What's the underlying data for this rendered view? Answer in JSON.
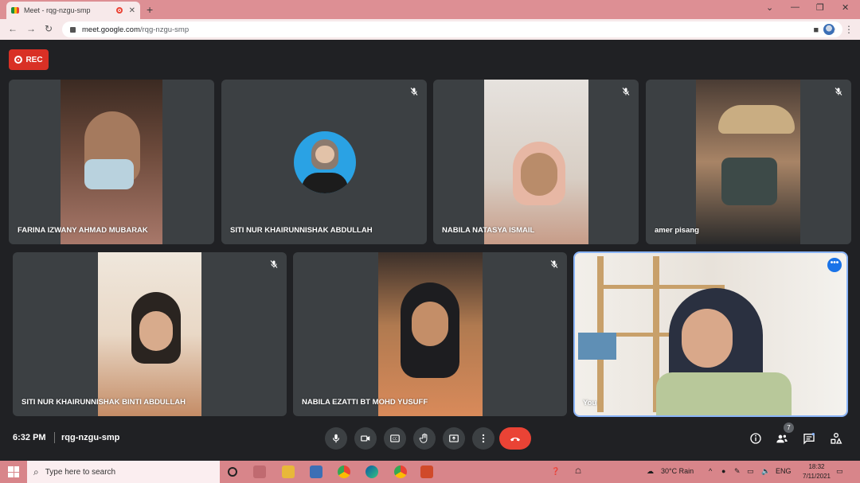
{
  "browser": {
    "tab_title": "Meet - rqg-nzgu-smp",
    "url_host": "meet.google.com",
    "url_path": "/rqg-nzgu-smp"
  },
  "meet": {
    "rec_label": "REC",
    "participants": [
      {
        "name": "FARINA IZWANY AHMAD MUBARAK",
        "muted": false,
        "bg": "#6b4a3a"
      },
      {
        "name": "SITI NUR KHAIRUNNISHAK ABDULLAH",
        "muted": true,
        "bg": "#3c4043"
      },
      {
        "name": "NABILA NATASYA ISMAIL",
        "muted": true,
        "bg": "#d9cfc7"
      },
      {
        "name": "amer pisang",
        "muted": true,
        "bg": "#8b6a4a"
      },
      {
        "name": "SITI NUR KHAIRUNNISHAK BINTI ABDULLAH",
        "muted": true,
        "bg": "#e8ddd0"
      },
      {
        "name": "NABILA EZATTI BT MOHD YUSUFF",
        "muted": true,
        "bg": "#7a5a3a"
      },
      {
        "name": "You",
        "muted": false,
        "bg": "#efe9e1"
      }
    ],
    "time": "6:32 PM",
    "meeting_code": "rqg-nzgu-smp",
    "people_count": "7"
  },
  "taskbar": {
    "search_placeholder": "Type here to search",
    "weather": "30°C  Rain",
    "language": "ENG",
    "clock_time": "18:32",
    "clock_date": "7/11/2021"
  },
  "colors": {
    "meet_bg": "#202124",
    "tile_bg": "#3c4043",
    "accent_red": "#ea4335",
    "self_outline": "#8ab4f8",
    "chrome_frame": "#dd8f94"
  }
}
